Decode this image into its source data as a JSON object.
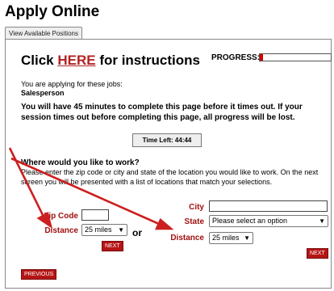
{
  "page_title": "Apply Online",
  "tab": {
    "label": "View Available Positions"
  },
  "instructions": {
    "prefix": "Click ",
    "link": "HERE",
    "suffix": " for instructions"
  },
  "progress": {
    "label": "PROGRESS:",
    "fraction": 0.04
  },
  "applying": {
    "text": "You are applying for these jobs:",
    "job": "Salesperson"
  },
  "warning": "You will have 45 minutes to complete this page before it times out. If your session times out before completing this page, all progress will be lost.",
  "timer": "Time Left: 44:44",
  "where": {
    "heading": "Where would you like to work?",
    "description": "Please enter the zip code or city and state of the location you would like to work. On the next screen you will be presented with a list of locations that match your selections."
  },
  "zip_form": {
    "zip_label": "Zip Code",
    "zip_value": "",
    "distance_label": "Distance",
    "distance_value": "25 miles",
    "next": "NEXT"
  },
  "or_text": "or",
  "city_form": {
    "city_label": "City",
    "city_value": "",
    "state_label": "State",
    "state_value": "Please select an option",
    "distance_label": "Distance",
    "distance_value": "25 miles",
    "next": "NEXT"
  },
  "previous": "PREVIOUS",
  "colors": {
    "accent": "#b51515",
    "label": "#a01010",
    "arrow": "#cc2020"
  }
}
